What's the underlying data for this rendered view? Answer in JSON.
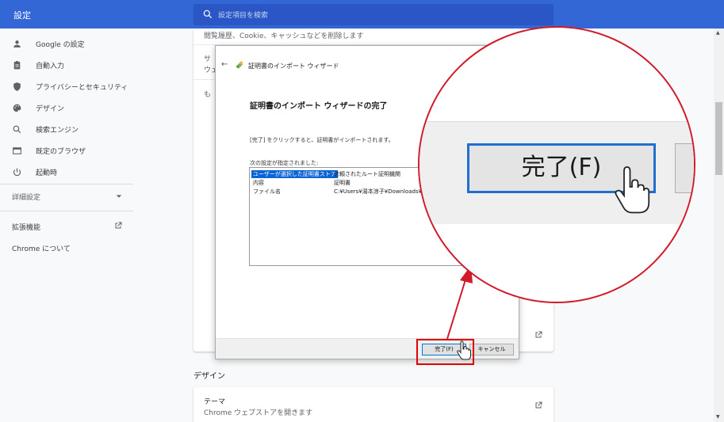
{
  "header": {
    "app_title": "設定",
    "search_placeholder": "設定項目を検索"
  },
  "sidebar": {
    "items": [
      {
        "label": "Google の設定",
        "icon": "person-icon"
      },
      {
        "label": "自動入力",
        "icon": "clipboard-icon"
      },
      {
        "label": "プライバシーとセキュリティ",
        "icon": "shield-icon"
      },
      {
        "label": "デザイン",
        "icon": "palette-icon"
      },
      {
        "label": "検索エンジン",
        "icon": "search-icon"
      },
      {
        "label": "既定のブラウザ",
        "icon": "browser-icon"
      },
      {
        "label": "起動時",
        "icon": "power-icon"
      }
    ],
    "advanced_label": "詳細設定",
    "extensions_label": "拡張機能",
    "about_label": "Chrome について"
  },
  "main": {
    "top_row_text": "閲覧履歴、Cookie、キャッシュなどを削除します",
    "partial_row_1": "サ",
    "partial_row_2": "ウェ",
    "partial_row_3": "も",
    "design_section_title": "デザイン",
    "theme": {
      "title": "テーマ",
      "subtitle": "Chrome ウェブストアを開きます"
    }
  },
  "wizard": {
    "window_title": "証明書のインポート ウィザード",
    "back_glyph": "←",
    "heading": "証明書のインポート ウィザードの完了",
    "description": "[完了] をクリックすると、証明書がインポートされます。",
    "list_label": "次の設定が指定されました:",
    "settings": [
      {
        "key": "ユーザーが選択した証明書ストア",
        "value": "信頼されたルート証明機関",
        "selected": true
      },
      {
        "key": "内容",
        "value": "証明書",
        "selected": false
      },
      {
        "key": "ファイル名",
        "value": "C:¥Users¥湯本涼子¥Downloads¥",
        "selected": false
      }
    ],
    "finish_label": "完了(F)",
    "cancel_label": "キャンセル"
  },
  "magnifier": {
    "finish_label": "完了(F)"
  },
  "colors": {
    "header_bg": "#3367d6",
    "search_bg": "#2a56c6",
    "callout_red": "#d11a2a",
    "focus_blue": "#1f6fd0",
    "selection_blue": "#0a64d6"
  }
}
